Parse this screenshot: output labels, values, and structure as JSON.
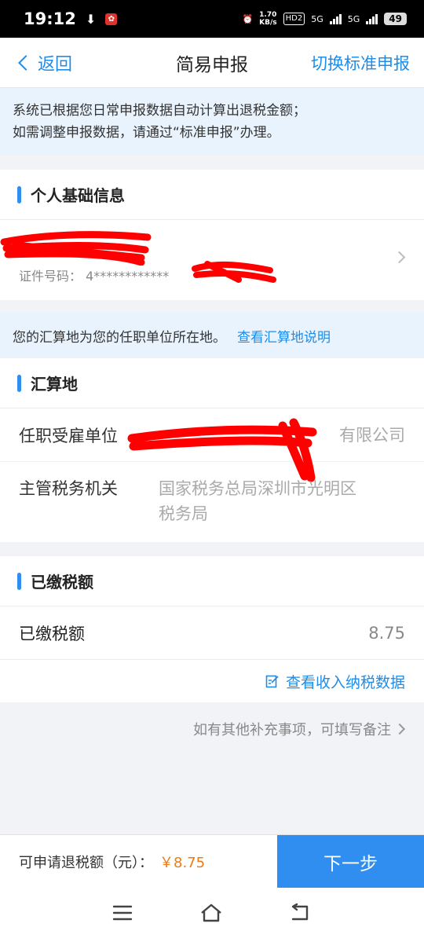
{
  "status_bar": {
    "time": "19:12",
    "download_glyph": "⬇",
    "net_speed": "1.70",
    "net_unit": "KB/s",
    "hd_badge": "HD2",
    "signal_1": "5G",
    "signal_2": "5G",
    "battery": "49"
  },
  "nav": {
    "back_label": "返回",
    "title": "简易申报",
    "switch_label": "切换标准申报"
  },
  "banner": {
    "line1": "系统已根据您日常申报数据自动计算出退税金额；",
    "line2": "如需调整申报数据，请通过“标准申报”办理。"
  },
  "personal": {
    "section_title": "个人基础信息",
    "id_label": "证件号码：",
    "id_value": "4************"
  },
  "hint": {
    "text": "您的汇算地为您的任职单位所在地。",
    "link": "查看汇算地说明"
  },
  "settlement": {
    "section_title": "汇算地",
    "employer_label": "任职受雇单位",
    "employer_value": "有限公司",
    "tax_office_label": "主管税务机关",
    "tax_office_value_line1": "国家税务总局深圳市光明区",
    "tax_office_value_line2": "税务局"
  },
  "paid_tax": {
    "section_title": "已缴税额",
    "row_label": "已缴税额",
    "row_value": "8.75",
    "link_label": "查看收入纳税数据"
  },
  "remark": {
    "text": "如有其他补充事项，可填写备注"
  },
  "bottom": {
    "refund_label": "可申请退税额（元）：",
    "refund_amount": "￥8.75",
    "next_label": "下一步"
  },
  "colors": {
    "accent": "#2f8ef0",
    "link": "#1f8ce8",
    "amount": "#f07a12",
    "redaction": "#ff0000"
  }
}
